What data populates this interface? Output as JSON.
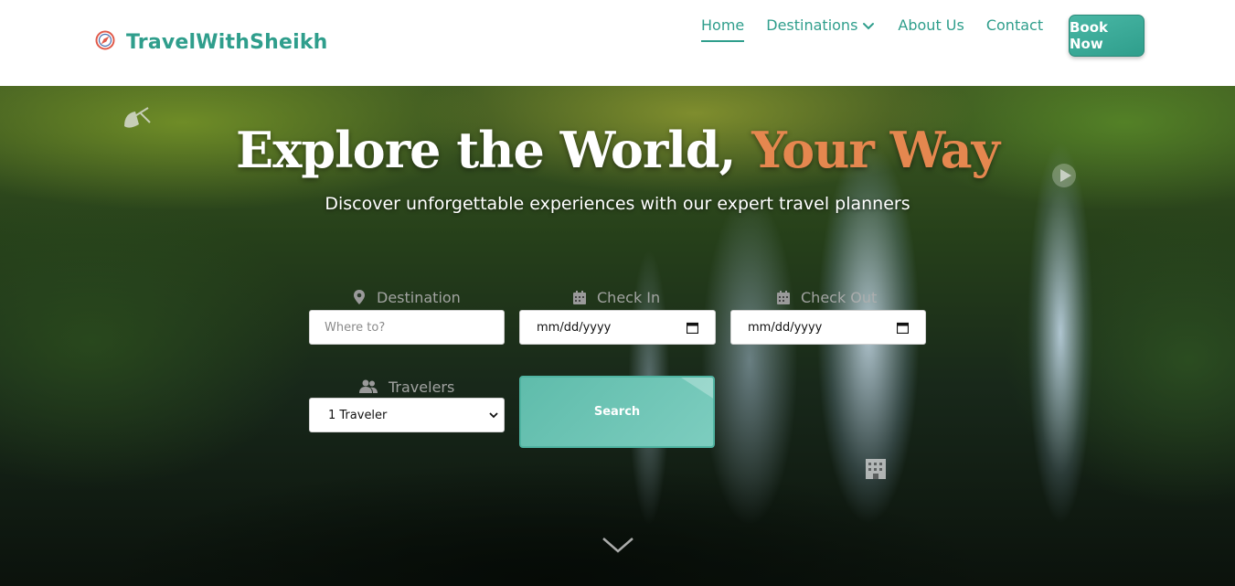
{
  "header": {
    "brand": "TravelWithSheikh",
    "nav": [
      {
        "label": "Home",
        "active": true
      },
      {
        "label": "Destinations",
        "dropdown": true
      },
      {
        "label": "About Us"
      },
      {
        "label": "Contact"
      }
    ],
    "cta_label": "Book Now"
  },
  "hero": {
    "title_main": "Explore the World, ",
    "title_accent": "Your Way",
    "subtitle": "Discover unforgettable experiences with our expert travel planners",
    "form": {
      "destination_label": "Destination",
      "destination_placeholder": "Where to?",
      "checkin_label": "Check In",
      "checkin_value": "mm/dd/yyyy",
      "checkout_label": "Check Out",
      "checkout_value": "mm/dd/yyyy",
      "travelers_label": "Travelers",
      "travelers_value": "1 Traveler",
      "search_label": "Search"
    }
  },
  "colors": {
    "brand": "#2f9e8c",
    "accent": "#e5874f",
    "search_button": "#6cc4b5"
  },
  "icons": [
    "compass-icon",
    "chevron-down-icon",
    "satellite-icon",
    "play-icon",
    "hotel-icon",
    "map-pin-icon",
    "calendar-icon",
    "users-icon",
    "scroll-down-icon"
  ]
}
